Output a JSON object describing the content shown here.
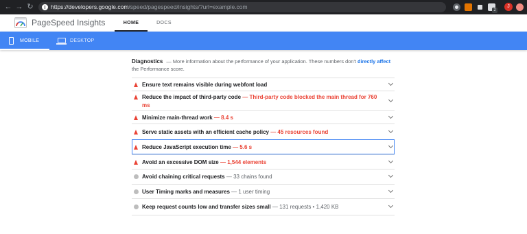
{
  "browser": {
    "url_host": "https://developers.google.com",
    "url_path": "/speed/pagespeed/insights/?url=example.com",
    "icons": {
      "back": "back-arrow-icon",
      "forward": "forward-arrow-icon",
      "reload": "reload-icon",
      "info": "info-icon"
    },
    "extension_badge": "2",
    "avatar_initial": "J"
  },
  "header": {
    "title": "PageSpeed Insights",
    "tabs": [
      {
        "label": "HOME",
        "active": true
      },
      {
        "label": "DOCS",
        "active": false
      }
    ]
  },
  "devices": [
    {
      "label": "MOBILE",
      "icon": "mobile-icon",
      "active": true
    },
    {
      "label": "DESKTOP",
      "icon": "desktop-icon",
      "active": false
    }
  ],
  "diagnostics": {
    "title": "Diagnostics",
    "description_pre": "— More information about the performance of your application. These numbers don't",
    "description_link": "directly affect",
    "description_post": "the Performance score.",
    "audits": [
      {
        "title": "Ensure text remains visible during webfont load",
        "value": "",
        "status": "fail"
      },
      {
        "title": "Reduce the impact of third-party code",
        "value": "— Third-party code blocked the main thread for 760 ms",
        "status": "fail"
      },
      {
        "title": "Minimize main-thread work",
        "value": "— 8.4 s",
        "status": "fail"
      },
      {
        "title": "Serve static assets with an efficient cache policy",
        "value": "— 45 resources found",
        "status": "fail"
      },
      {
        "title": "Reduce JavaScript execution time",
        "value": "— 5.6 s",
        "status": "fail",
        "focused": true
      },
      {
        "title": "Avoid an excessive DOM size",
        "value": "— 1,544 elements",
        "status": "fail"
      },
      {
        "title": "Avoid chaining critical requests",
        "value": "— 33 chains found",
        "status": "info"
      },
      {
        "title": "User Timing marks and measures",
        "value": "— 1 user timing",
        "status": "info"
      },
      {
        "title": "Keep request counts low and transfer sizes small",
        "value": "— 131 requests • 1,420 KB",
        "status": "info"
      }
    ]
  },
  "colors": {
    "brand_blue": "#4285f4",
    "fail_red": "#ea4335",
    "info_gray": "#bdbdbd",
    "link_blue": "#1a73e8"
  }
}
